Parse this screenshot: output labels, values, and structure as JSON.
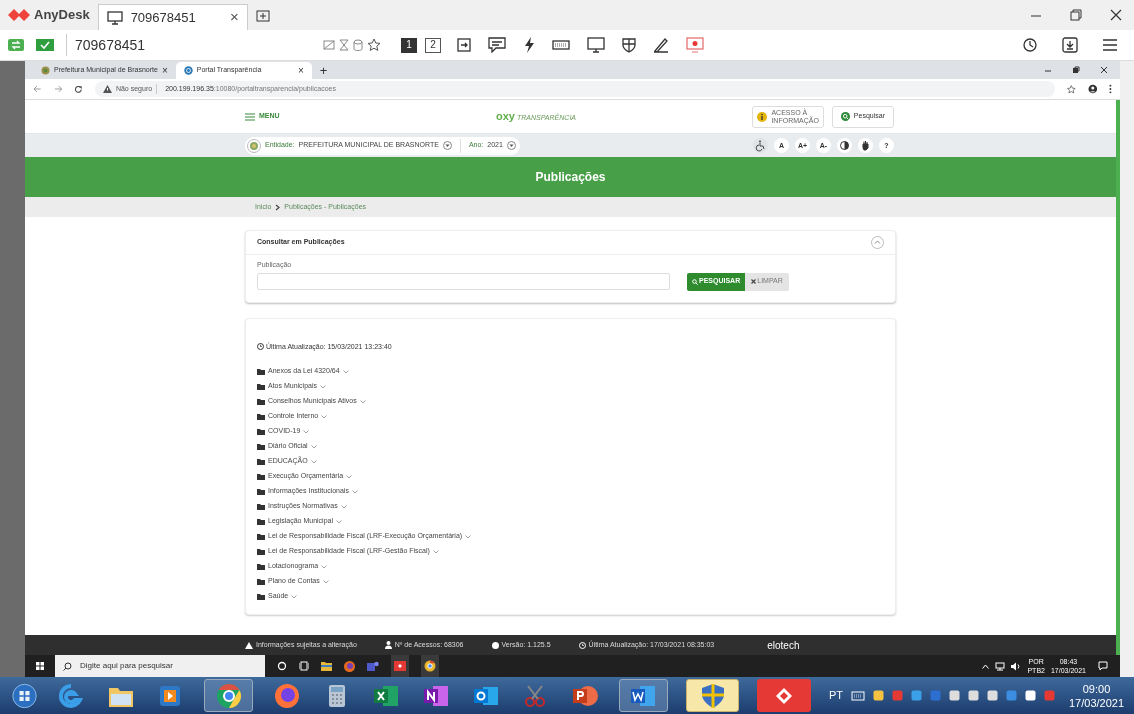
{
  "anydesk": {
    "app_name": "AnyDesk",
    "tab": {
      "title": "709678451",
      "close": "×"
    },
    "address": "709678451",
    "monitors": [
      {
        "label": "1",
        "selected": true
      },
      {
        "label": "2",
        "selected": false
      }
    ]
  },
  "browser": {
    "tabs": [
      {
        "title": "Prefeitura Municipal de Brasnorte",
        "selected": false,
        "close": "×"
      },
      {
        "title": "Portal Transparência",
        "selected": true,
        "close": "×"
      }
    ],
    "new_tab": "+",
    "security": "Não seguro",
    "host": "200.199.196.35",
    "path": ":10080/portaltransparencia/publicacoes"
  },
  "header": {
    "menu": "MENU",
    "logo_prefix": "oxy",
    "logo": "TRANSPARÊNCIA",
    "access_lines": [
      "ACESSO À",
      "INFORMAÇÃO"
    ],
    "search_button": "Pesquisar"
  },
  "entity_bar": {
    "entity_label": "Entidade:",
    "entity_value": "PREFEITURA MUNICIPAL DE BRASNORTE",
    "year_label": "Ano:",
    "year_value": "2021",
    "tools": [
      {
        "kind": "wheelchair"
      },
      {
        "kind": "text",
        "label": "A"
      },
      {
        "kind": "text",
        "label": "A+"
      },
      {
        "kind": "text",
        "label": "A-"
      },
      {
        "kind": "contrast"
      },
      {
        "kind": "hand"
      },
      {
        "kind": "text",
        "label": "?"
      }
    ]
  },
  "banner": {
    "title": "Publicações"
  },
  "breadcrumb": [
    "Inicio",
    "Publicações - Publicações"
  ],
  "search_card": {
    "title": "Consultar em Publicações",
    "field_label": "Publicação",
    "search_button": "PESQUISAR",
    "clear_button": "LIMPAR"
  },
  "list_card": {
    "updated": "Última Atualização: 15/03/2021 13:23:40",
    "folders": [
      {
        "label": "Anexos da Lei 4320/64"
      },
      {
        "label": "Atos Municipais"
      },
      {
        "label": "Conselhos Municipais Ativos"
      },
      {
        "label": "Controle Interno"
      },
      {
        "label": "COVID-19"
      },
      {
        "label": "Diário Oficial"
      },
      {
        "label": "EDUCAÇÃO"
      },
      {
        "label": "Execução Orçamentária"
      },
      {
        "label": "Informações Institucionais"
      },
      {
        "label": "Instruções Normativas"
      },
      {
        "label": "Legislação Municipal"
      },
      {
        "label": "Lei de Responsabilidade Fiscal (LRF-Execução Orçamentária)"
      },
      {
        "label": "Lei de Responsabilidade Fiscal (LRF-Gestão Fiscal)"
      },
      {
        "label": "Lotacionograma"
      },
      {
        "label": "Plano de Contas"
      },
      {
        "label": "Saúde"
      }
    ]
  },
  "footer": {
    "items": [
      {
        "kind": "warning",
        "text": "Informações sujeitas a alteração"
      },
      {
        "kind": "user",
        "text": "Nº de Acessos: 68306"
      },
      {
        "kind": "dot",
        "text": "Versão: 1.125.5"
      },
      {
        "kind": "clock",
        "text": "Última Atualização: 17/03/2021 08:35:03"
      }
    ],
    "brand": "elotech"
  },
  "remote_taskbar": {
    "search_placeholder": "Digite aqui para pesquisar",
    "lang": "POR",
    "layout": "PTB2",
    "time": "08:43",
    "date": "17/03/2021"
  },
  "local_taskbar": {
    "lang": "PT",
    "time": "09:00",
    "date": "17/03/2021"
  }
}
